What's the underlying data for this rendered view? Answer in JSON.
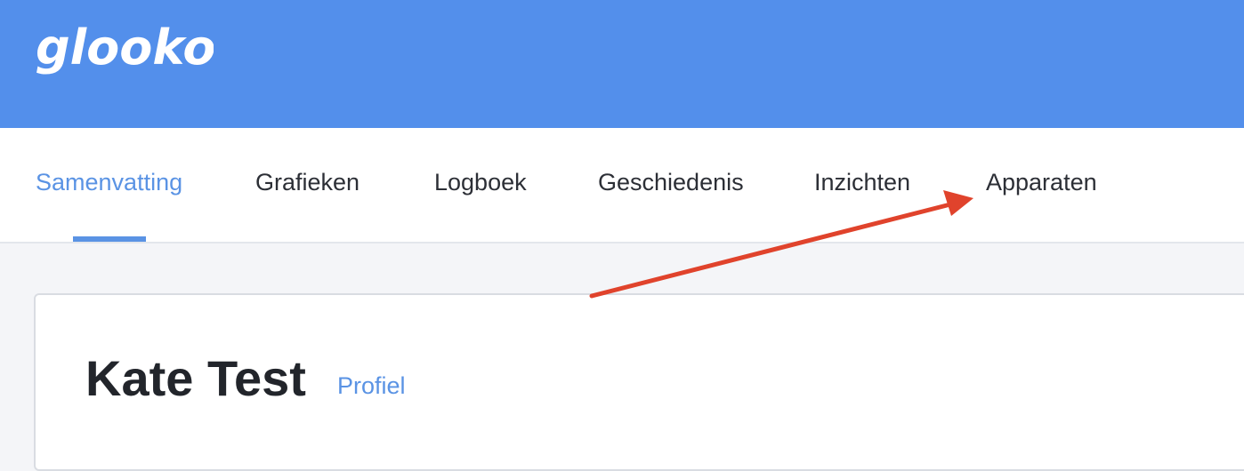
{
  "header": {
    "logo_text": "glooko",
    "background_color": "#538feb"
  },
  "tabs": [
    {
      "label": "Samenvatting",
      "active": true
    },
    {
      "label": "Grafieken",
      "active": false
    },
    {
      "label": "Logboek",
      "active": false
    },
    {
      "label": "Geschiedenis",
      "active": false
    },
    {
      "label": "Inzichten",
      "active": false
    },
    {
      "label": "Apparaten",
      "active": false
    }
  ],
  "patient": {
    "name": "Kate Test",
    "profile_link": "Profiel"
  },
  "colors": {
    "accent": "#5a93e4",
    "annotation_arrow": "#e0432c"
  },
  "annotation": {
    "type": "arrow",
    "points_to": "Apparaten"
  }
}
